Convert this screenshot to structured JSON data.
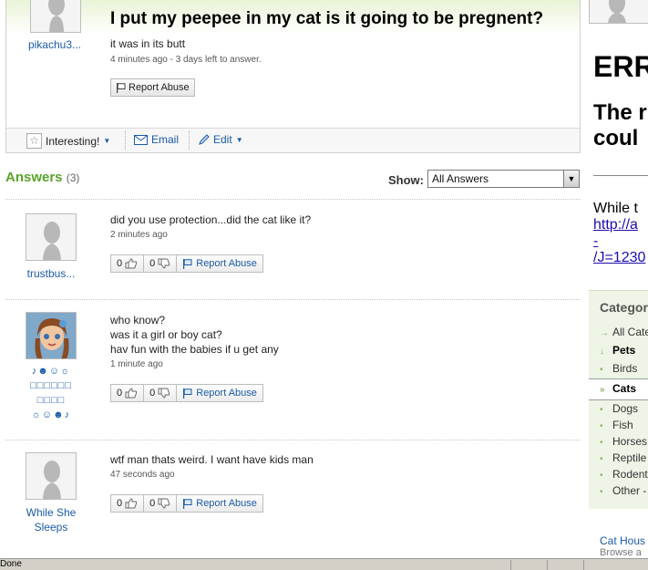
{
  "question": {
    "username": "pikachu3...",
    "title": "I put my peepee in my cat is it going to be pregnent?",
    "detail": "it was in its butt",
    "meta": "4 minutes ago - 3 days left to answer.",
    "report_label": "Report Abuse",
    "toolbar": {
      "interesting_label": "Interesting!",
      "email_label": "Email",
      "edit_label": "Edit"
    }
  },
  "answers_header": {
    "title": "Answers",
    "count": "(3)",
    "show_label": "Show:",
    "filter_value": "All Answers"
  },
  "answers": [
    {
      "username": "trustbus...",
      "lines": [
        "did you use protection...did the cat like it?"
      ],
      "meta": "2 minutes ago",
      "thumbs_up": "0",
      "thumbs_down": "0",
      "report_label": "Report Abuse"
    },
    {
      "username_lines": [
        "♪☻☺☼",
        "□□□□□□",
        "□□□□",
        "☼☺☻♪"
      ],
      "lines": [
        "who know?",
        "was it a girl or boy cat?",
        "hav fun with the babies if u get any"
      ],
      "meta": "1 minute ago",
      "thumbs_up": "0",
      "thumbs_down": "0",
      "report_label": "Report Abuse"
    },
    {
      "username_lines": [
        "While She",
        "Sleeps"
      ],
      "lines": [
        "wtf man thats weird. I want have kids man"
      ],
      "meta": "47 seconds ago",
      "thumbs_up": "0",
      "thumbs_down": "0",
      "report_label": "Report Abuse"
    }
  ],
  "right": {
    "error_title": "ERR",
    "error_sub_lines": [
      "The r",
      "coul"
    ],
    "while_text": "While t",
    "link_lines": [
      "http://a",
      "-",
      "/J=1230"
    ],
    "categories_title": "Categor",
    "categories": [
      {
        "marker": "→",
        "label": "All Cate",
        "bold": false
      },
      {
        "marker": "↓",
        "label": "Pets",
        "bold": true
      },
      {
        "marker": "•",
        "label": "Birds",
        "bold": false
      },
      {
        "marker": "»",
        "label": "Cats",
        "bold": true
      },
      {
        "marker": "•",
        "label": "Dogs",
        "bold": false
      },
      {
        "marker": "•",
        "label": "Fish",
        "bold": false
      },
      {
        "marker": "•",
        "label": "Horses",
        "bold": false
      },
      {
        "marker": "•",
        "label": "Reptile",
        "bold": false
      },
      {
        "marker": "•",
        "label": "Rodent",
        "bold": false
      },
      {
        "marker": "•",
        "label": "Other -",
        "bold": false
      }
    ],
    "cat_house_link": "Cat Hous",
    "browse_text": "Browse a"
  },
  "status_bar": {
    "text": "Done"
  }
}
